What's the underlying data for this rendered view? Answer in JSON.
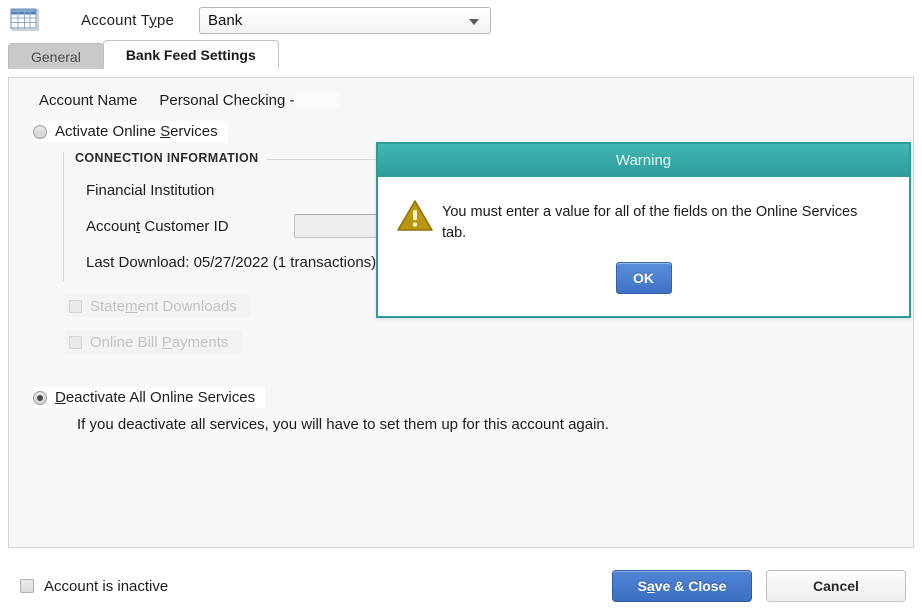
{
  "window": {
    "icon": "spreadsheet-grid-icon"
  },
  "header": {
    "account_type_label_pre": "Account T",
    "account_type_label_mn": "y",
    "account_type_label_post": "pe",
    "account_type_value": "Bank",
    "dropdown_icon": "chevron-down-icon"
  },
  "tabs": [
    {
      "label": "General",
      "active": false
    },
    {
      "label": "Bank Feed Settings",
      "active": true
    }
  ],
  "main": {
    "account_name_label": "Account Name",
    "account_name_value": "Personal Checking -",
    "activate": {
      "label_pre": "Activate Online ",
      "label_mn": "S",
      "label_post": "ervices",
      "selected": false
    },
    "connection": {
      "title": "CONNECTION INFORMATION",
      "financial_institution_label": "Financial Institution",
      "financial_institution_value": "",
      "customer_id_label_pre": "Accoun",
      "customer_id_label_mn": "t",
      "customer_id_label_post": " Customer ID",
      "customer_id_value": "",
      "customer_id_placeholder": "",
      "last_download": "Last Download: 05/27/2022 (1 transactions)"
    },
    "statement_downloads": {
      "label_pre": "State",
      "label_mn": "m",
      "label_post": "ent Downloads",
      "checked": false,
      "disabled": true
    },
    "online_bill_payments": {
      "label_pre": "Online Bill ",
      "label_mn": "P",
      "label_post": "ayments",
      "checked": false,
      "disabled": true
    },
    "deactivate": {
      "label_mn": "D",
      "label_post": "eactivate All Online Services",
      "selected": true,
      "note": "If you deactivate all services, you will have to set them up for this account again."
    }
  },
  "footer": {
    "inactive_label": "Account is inactive",
    "inactive_checked": false,
    "save_label_pre": "S",
    "save_label_mn": "a",
    "save_label_post": "ve & Close",
    "cancel_label": "Cancel"
  },
  "dialog": {
    "title": "Warning",
    "icon": "warning-triangle-icon",
    "message": "You must enter a value for all of the fields on the Online Services tab.",
    "ok_label": "OK"
  },
  "colors": {
    "dialog_accent": "#2e9a99",
    "primary_button": "#3f72c6",
    "warning_icon": "#b9960f",
    "panel_bg": "#f7f7f7",
    "tab_inactive": "#c9c9c9",
    "disabled_text": "#c3c3c3"
  }
}
